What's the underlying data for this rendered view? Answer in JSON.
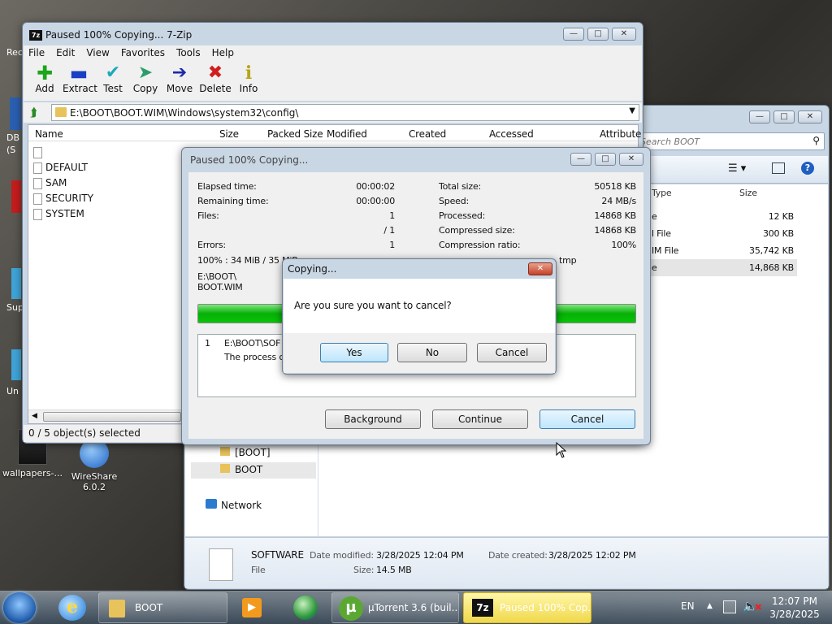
{
  "desktop": {
    "icons": [
      {
        "label": "wallpapers-..."
      },
      {
        "label": "WireShare 6.0.2"
      }
    ],
    "partials": [
      "Rec",
      "DB",
      "(S",
      "Sup",
      "Un"
    ]
  },
  "explorer": {
    "search_placeholder": "Search BOOT",
    "col_type": "Type",
    "col_size": "Size",
    "rows": [
      {
        "type": "e",
        "size": "12 KB"
      },
      {
        "type": "l File",
        "size": "300 KB"
      },
      {
        "type": "IM File",
        "size": "35,742 KB"
      },
      {
        "type": "e",
        "size": "14,868 KB"
      }
    ],
    "tree": [
      {
        "label": "[BOOT]"
      },
      {
        "label": "BOOT"
      }
    ],
    "network": "Network",
    "details": {
      "name": "SOFTWARE",
      "modified_label": "Date modified:",
      "modified": "3/28/2025 12:04 PM",
      "created_label": "Date created:",
      "created": "3/28/2025 12:02 PM",
      "type": "File",
      "size_label": "Size:",
      "size": "14.5 MB"
    }
  },
  "zip": {
    "title": "Paused 100% Copying... 7-Zip",
    "menu": [
      "File",
      "Edit",
      "View",
      "Favorites",
      "Tools",
      "Help"
    ],
    "toolbar": [
      {
        "label": "Add",
        "icon": "plus-icon",
        "color": "#1aa51a"
      },
      {
        "label": "Extract",
        "icon": "minus-icon",
        "color": "#1a3fc4"
      },
      {
        "label": "Test",
        "icon": "check-icon",
        "color": "#1fa9b8"
      },
      {
        "label": "Copy",
        "icon": "copy-arrow-icon",
        "color": "#2a9d6a"
      },
      {
        "label": "Move",
        "icon": "move-arrow-icon",
        "color": "#1a2aa8"
      },
      {
        "label": "Delete",
        "icon": "delete-x-icon",
        "color": "#d21d1d"
      },
      {
        "label": "Info",
        "icon": "info-icon",
        "color": "#b8a51a"
      }
    ],
    "path": "E:\\BOOT\\BOOT.WIM\\Windows\\system32\\config\\",
    "columns": [
      "Name",
      "Size",
      "Packed Size",
      "Modified",
      "Created",
      "Accessed",
      "Attribute"
    ],
    "files": [
      "",
      "DEFAULT",
      "SAM",
      "SECURITY",
      "SYSTEM"
    ],
    "status": "0 / 5 object(s) selected"
  },
  "progress": {
    "title": "Paused 100% Copying...",
    "elapsed_label": "Elapsed time:",
    "elapsed": "00:00:02",
    "remaining_label": "Remaining time:",
    "remaining": "00:00:00",
    "files_label": "Files:",
    "files": "1",
    "files_total": "/ 1",
    "errors_label": "Errors:",
    "errors": "1",
    "total_label": "Total size:",
    "total": "50518 KB",
    "speed_label": "Speed:",
    "speed": "24 MB/s",
    "processed_label": "Processed:",
    "processed": "14868 KB",
    "compressed_label": "Compressed size:",
    "compressed": "14868 KB",
    "ratio_label": "Compression ratio:",
    "ratio": "100%",
    "summary_left": "100% : 34 MiB / 35 MiB",
    "summary_right": "tmp",
    "src1": "E:\\BOOT\\",
    "src2": "BOOT.WIM",
    "fill": 1.0,
    "log_num": "1",
    "log_path": "E:\\BOOT\\SOF",
    "log_msg": "The process ca",
    "btn_background": "Background",
    "btn_continue": "Continue",
    "btn_cancel": "Cancel"
  },
  "confirm": {
    "title": "Copying...",
    "message": "Are you sure you want to cancel?",
    "yes": "Yes",
    "no": "No",
    "cancel": "Cancel"
  },
  "taskbar": {
    "items": [
      {
        "label": "BOOT"
      },
      {
        "label": "µTorrent 3.6  (buil..."
      },
      {
        "label": "Paused 100% Cop..."
      }
    ],
    "lang": "EN",
    "time": "12:07 PM",
    "date": "3/28/2025"
  }
}
